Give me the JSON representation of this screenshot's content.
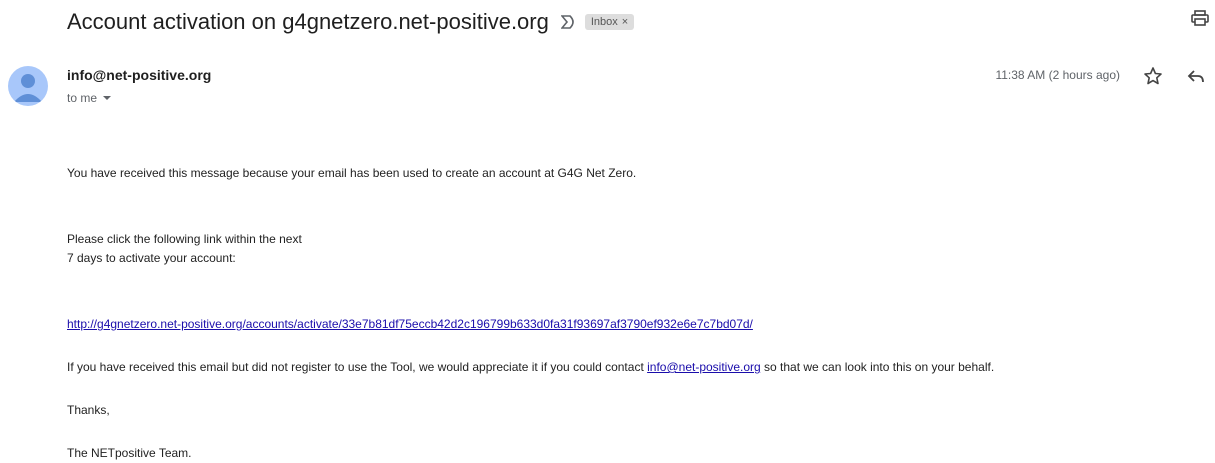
{
  "subject": "Account activation on g4gnetzero.net-positive.org",
  "label": {
    "text": "Inbox",
    "remove": "×"
  },
  "sender": "info@net-positive.org",
  "recipient": "to me",
  "time": "11:38 AM (2 hours ago)",
  "icons": [
    "important-icon",
    "print-icon",
    "avatar",
    "star-icon",
    "reply-icon",
    "chevron-down-icon"
  ],
  "colors": {
    "avatar_bg": "#a8c7fa",
    "avatar_fg": "#5f8fd7",
    "link": "#1a0dab",
    "chip_bg": "#dddddd"
  },
  "message": {
    "intro": "You have received this message because your email has been used to create an account at G4G Net Zero.",
    "instruction_line1": "Please click the following link within the next",
    "instruction_line2": "7 days to activate your account:",
    "activation_link": "http://g4gnetzero.net-positive.org/accounts/activate/33e7b81df75eccb42d2c196799b633d0fa31f93697af3790ef932e6e7c7bd07d/",
    "notice_before": "If you have received this email but did not register to use the Tool, we would appreciate it if you could contact ",
    "notice_link": "info@net-positive.org",
    "notice_after": " so that we can look into this on your behalf.",
    "thanks": "Thanks,",
    "signature": "The NETpositive Team."
  }
}
